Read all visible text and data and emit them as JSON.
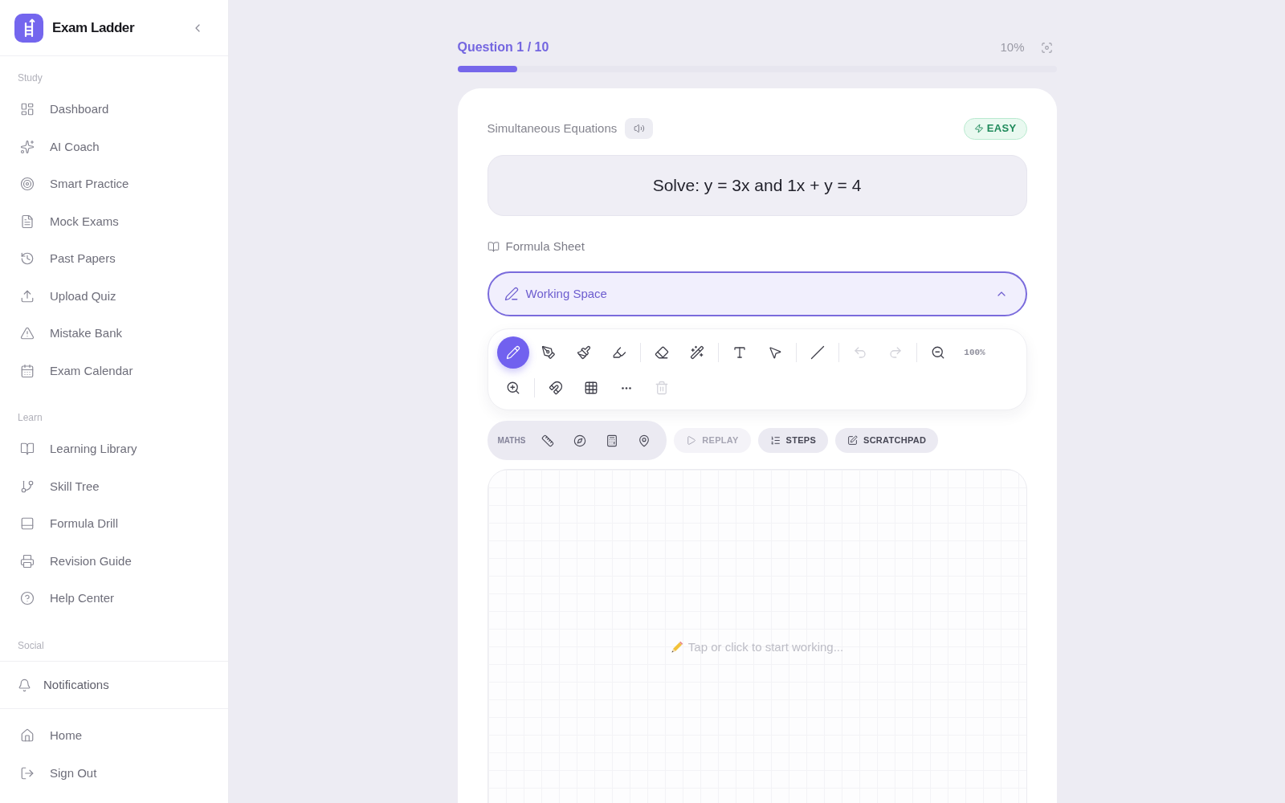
{
  "sidebar": {
    "brand": "Exam Ladder",
    "sections": [
      {
        "label": "Study",
        "items": [
          {
            "label": "Dashboard"
          },
          {
            "label": "AI Coach"
          },
          {
            "label": "Smart Practice"
          },
          {
            "label": "Mock Exams"
          },
          {
            "label": "Past Papers"
          },
          {
            "label": "Upload Quiz"
          },
          {
            "label": "Mistake Bank"
          },
          {
            "label": "Exam Calendar"
          }
        ]
      },
      {
        "label": "Learn",
        "items": [
          {
            "label": "Learning Library"
          },
          {
            "label": "Skill Tree"
          },
          {
            "label": "Formula Drill"
          },
          {
            "label": "Revision Guide"
          },
          {
            "label": "Help Center"
          }
        ]
      },
      {
        "label": "Social"
      }
    ],
    "notifications": {
      "label": "Notifications"
    },
    "footer_items": [
      {
        "label": "Home"
      },
      {
        "label": "Sign Out"
      }
    ]
  },
  "progress": {
    "label": "Question 1 / 10",
    "level": 0.1,
    "percent": "10%"
  },
  "question": {
    "topic": "Simultaneous Equations",
    "difficulty": "EASY",
    "prompt": "Solve: y = 3x and 1x + y = 4"
  },
  "formula_sheet": {
    "label": "Formula Sheet"
  },
  "working_space": {
    "label": "Working Space",
    "expanded": true
  },
  "toolbar": {
    "groups": [
      {
        "items": [
          {
            "kind": "tool",
            "selected": true
          },
          {
            "kind": "tool",
            "selected": false
          },
          {
            "kind": "tool",
            "selected": false
          },
          {
            "kind": "tool",
            "selected": false
          }
        ]
      },
      {
        "items": [
          {
            "kind": "tool",
            "selected": false
          },
          {
            "kind": "tool",
            "selected": false
          }
        ]
      },
      {
        "items": [
          {
            "kind": "tool",
            "selected": false
          },
          {
            "kind": "tool",
            "selected": false
          }
        ]
      },
      {
        "items": [
          {
            "kind": "tool",
            "selected": false
          }
        ]
      },
      {
        "items": [
          {
            "kind": "action",
            "disabled": true
          },
          {
            "kind": "action",
            "disabled": true
          }
        ]
      },
      {
        "items": [
          {
            "kind": "action",
            "disabled": false
          },
          {
            "kind": "zoom_level",
            "text": "100%"
          },
          {
            "kind": "action",
            "disabled": false
          }
        ]
      },
      {
        "items": [
          {
            "kind": "action",
            "disabled": false
          },
          {
            "kind": "action",
            "disabled": false
          },
          {
            "kind": "action",
            "disabled": false
          },
          {
            "kind": "action",
            "disabled": true
          }
        ]
      }
    ]
  },
  "maths_tools": {
    "label": "MATHS"
  },
  "actions": [
    {
      "label": "REPLAY",
      "disabled": true
    },
    {
      "label": "STEPS",
      "disabled": false
    },
    {
      "label": "SCRATCHPAD",
      "disabled": false
    }
  ],
  "canvas": {
    "placeholder": "Tap or click to start working..."
  }
}
